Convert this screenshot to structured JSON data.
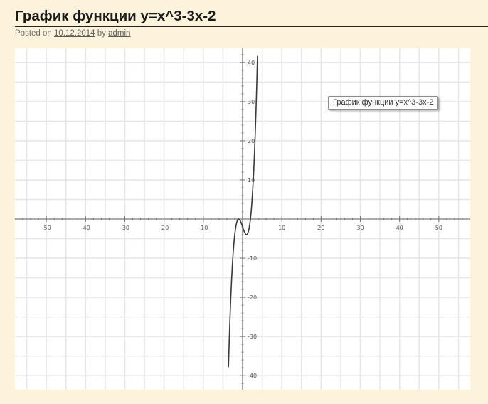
{
  "post": {
    "title": "График функции y=x^3-3x-2",
    "posted_on_label": "Posted on",
    "date": "10.12.2014",
    "by_label": "by",
    "author": "admin"
  },
  "colors": {
    "page_background": "#fdf3dc",
    "plot_background": "#ffffff",
    "grid": "#e6e6e6",
    "axis": "#777777",
    "curve": "#3a3a3a"
  },
  "chart_data": {
    "type": "line",
    "function": "y=x^3-3x-2",
    "legend": "График функции y=x^3-3x-2",
    "legend_position": "top-right",
    "grid": true,
    "xlim": [
      -58,
      58
    ],
    "ylim": [
      -43.6,
      43.6
    ],
    "x_ticks": [
      -50,
      -40,
      -30,
      -20,
      -10,
      10,
      20,
      30,
      40,
      50
    ],
    "x_tick_labels": [
      "-50",
      "-40",
      "-30",
      "-20",
      "-10",
      "10",
      "20",
      "30",
      "40",
      "50"
    ],
    "y_ticks": [
      40,
      30,
      20,
      10,
      -10,
      -20,
      -30,
      -40
    ],
    "y_tick_labels": [
      "40",
      "30",
      "20",
      "10",
      "-10",
      "-20",
      "-30",
      "-40"
    ],
    "series": [
      {
        "x": [
          -3.6,
          -3.4,
          -3.2,
          -3.0,
          -2.8,
          -2.6,
          -2.4,
          -2.2,
          -2.0,
          -1.8,
          -1.6,
          -1.4,
          -1.2,
          -1.0,
          -0.8,
          -0.6,
          -0.4,
          -0.2,
          0.0,
          0.2,
          0.4,
          0.6,
          0.8,
          1.0,
          1.2,
          1.4,
          1.6,
          1.8,
          2.0,
          2.2,
          2.4,
          2.6,
          2.8,
          3.0,
          3.2,
          3.4,
          3.6,
          3.8
        ],
        "y": [
          -37.86,
          -31.1,
          -25.17,
          -20.0,
          -15.55,
          -11.78,
          -8.62,
          -6.05,
          -4.0,
          -2.43,
          -1.3,
          -0.54,
          -0.13,
          0.0,
          -0.11,
          -0.42,
          -0.86,
          -1.41,
          -2.0,
          -2.59,
          -3.14,
          -3.58,
          -3.89,
          -4.0,
          -3.87,
          -3.46,
          -2.7,
          -1.57,
          0.0,
          2.05,
          4.62,
          7.78,
          11.55,
          16.0,
          21.17,
          27.1,
          33.86,
          41.67
        ]
      }
    ]
  }
}
